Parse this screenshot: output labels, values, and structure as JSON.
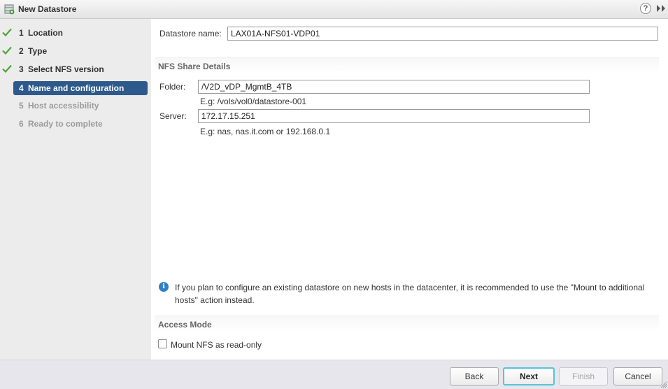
{
  "window": {
    "title": "New Datastore",
    "help_glyph": "?",
    "title_icon": "datastore-icon",
    "forward_icon": "double-chevron-right-icon"
  },
  "steps": [
    {
      "num": "1",
      "label": "Location",
      "state": "done"
    },
    {
      "num": "2",
      "label": "Type",
      "state": "done"
    },
    {
      "num": "3",
      "label": "Select NFS version",
      "state": "done"
    },
    {
      "num": "4",
      "label": "Name and configuration",
      "state": "active"
    },
    {
      "num": "5",
      "label": "Host accessibility",
      "state": "future"
    },
    {
      "num": "6",
      "label": "Ready to complete",
      "state": "future"
    }
  ],
  "form": {
    "datastore_name_label": "Datastore name:",
    "datastore_name_value": "LAX01A-NFS01-VDP01",
    "nfs_section_title": "NFS Share Details",
    "folder_label": "Folder:",
    "folder_value": "/V2D_vDP_MgmtB_4TB",
    "folder_hint": "E.g: /vols/vol0/datastore-001",
    "server_label": "Server:",
    "server_value": "172.17.15.251",
    "server_hint": "E.g: nas, nas.it.com or 192.168.0.1",
    "info_glyph": "i",
    "info_text": "If you plan to configure an existing datastore on new hosts in the datacenter, it is recommended to use the \"Mount to additional hosts\" action instead.",
    "access_section_title": "Access Mode",
    "readonly_label": "Mount NFS as read-only",
    "readonly_checked": false
  },
  "footer": {
    "back_label": "Back",
    "next_label": "Next",
    "finish_label": "Finish",
    "cancel_label": "Cancel"
  },
  "colors": {
    "active_step": "#2d5a8b",
    "check_mark": "#4aa832",
    "next_focus_border": "#56c4d6",
    "info_icon": "#2f7fc9"
  }
}
